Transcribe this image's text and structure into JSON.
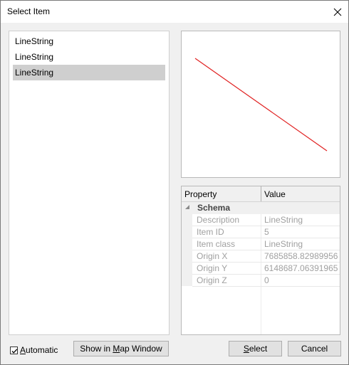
{
  "window": {
    "title": "Select Item"
  },
  "list": {
    "items": [
      {
        "label": "LineString",
        "selected": false
      },
      {
        "label": "LineString",
        "selected": false
      },
      {
        "label": "LineString",
        "selected": true
      }
    ]
  },
  "preview": {
    "stroke_color": "#e02020"
  },
  "properties": {
    "header_property": "Property",
    "header_value": "Value",
    "category": "Schema",
    "rows": [
      {
        "name": "Description",
        "value": "LineString"
      },
      {
        "name": "Item ID",
        "value": "5"
      },
      {
        "name": "Item class",
        "value": "LineString"
      },
      {
        "name": "Origin X",
        "value": "7685858.82989956"
      },
      {
        "name": "Origin Y",
        "value": "6148687.06391965"
      },
      {
        "name": "Origin Z",
        "value": "0"
      }
    ]
  },
  "footer": {
    "automatic_label_u": "A",
    "automatic_label_rest": "utomatic",
    "automatic_checked": true,
    "show_btn_pre": "Show in ",
    "show_btn_u": "M",
    "show_btn_post": "ap Window",
    "select_u": "S",
    "select_rest": "elect",
    "cancel": "Cancel"
  }
}
